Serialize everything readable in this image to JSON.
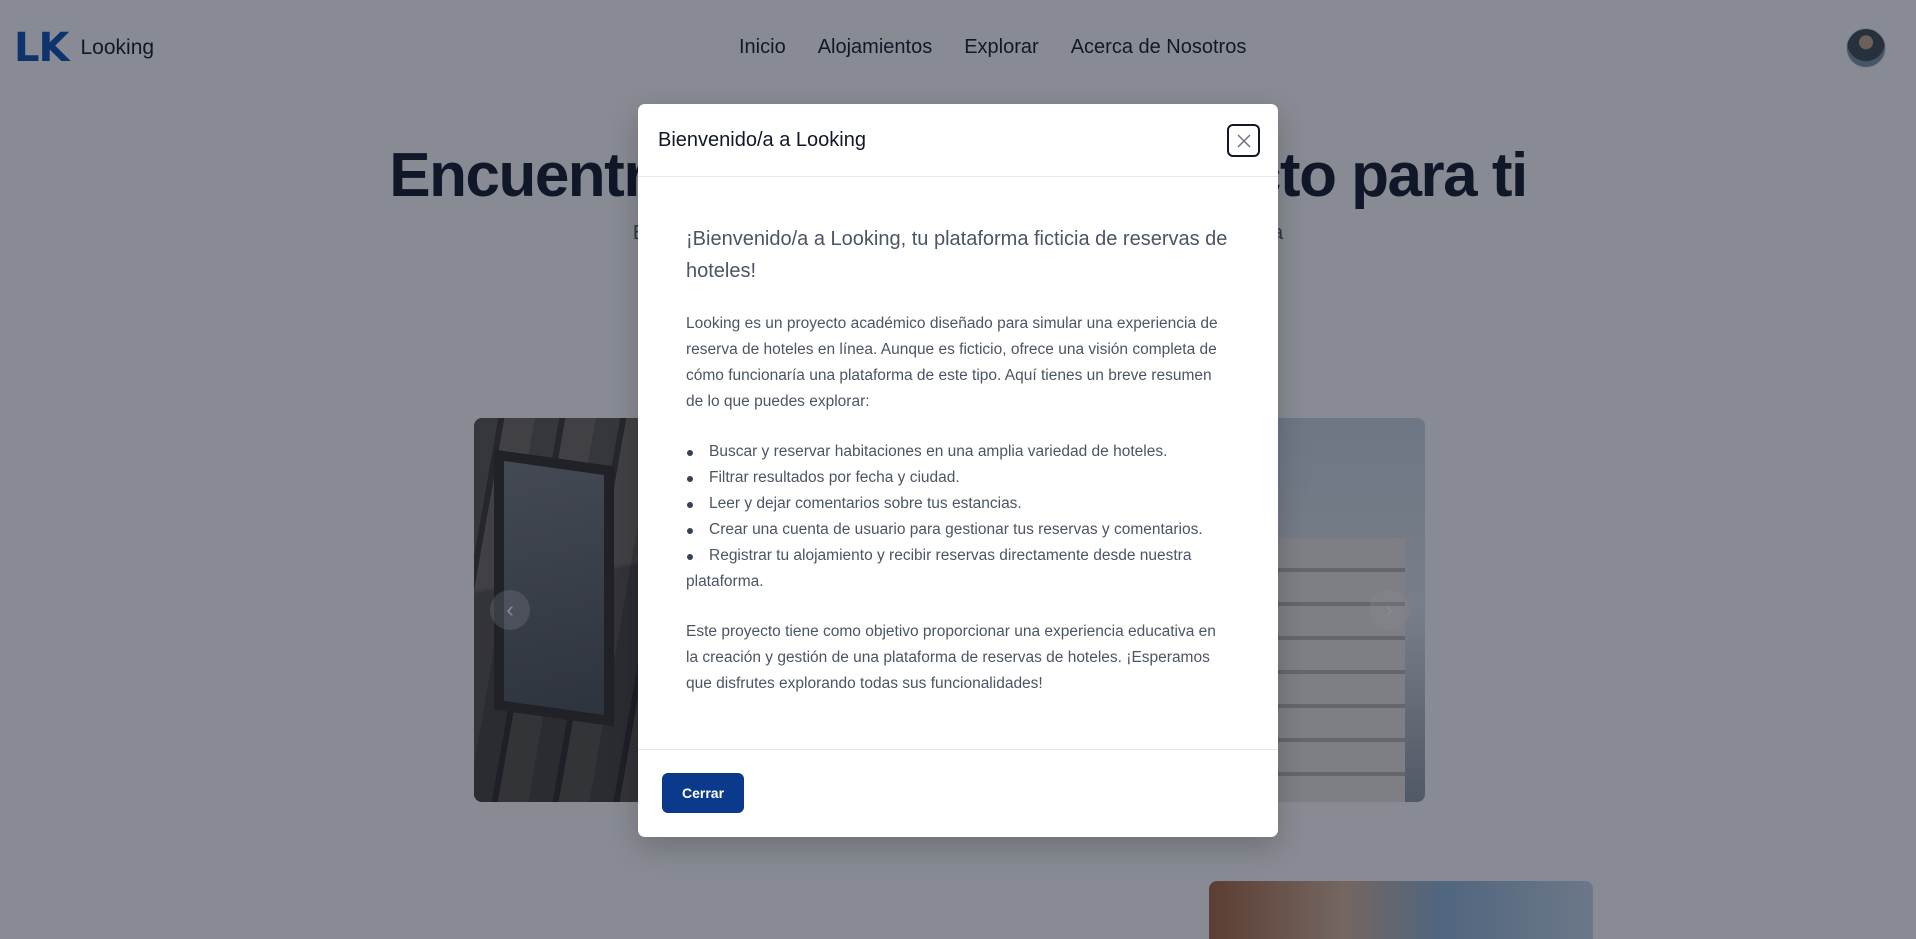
{
  "navbar": {
    "logo_mark": "LK",
    "logo_text": "Looking",
    "links": [
      {
        "label": "Inicio"
      },
      {
        "label": "Alojamientos"
      },
      {
        "label": "Explorar"
      },
      {
        "label": "Acerca de Nosotros"
      }
    ],
    "avatar_icon": "user-avatar"
  },
  "hero": {
    "title": "Encuentra el alojamiento perfecto para ti",
    "subtitle": "Explora nuestros alojamientos y reserva tu estancia ideal para tu próxima"
  },
  "carousel": {
    "prev_icon": "chevron-left-icon",
    "next_icon": "chevron-right-icon"
  },
  "modal": {
    "title": "Bienvenido/a a Looking",
    "close_icon": "close-icon",
    "lead": "¡Bienvenido/a a Looking, tu plataforma ficticia de reservas de hoteles!",
    "intro": "Looking es un proyecto académico diseñado para simular una experiencia de reserva de hoteles en línea. Aunque es ficticio, ofrece una visión completa de cómo funcionaría una plataforma de este tipo. Aquí tienes un breve resumen de lo que puedes explorar:",
    "features": [
      "Buscar y reservar habitaciones en una amplia variedad de hoteles.",
      "Filtrar resultados por fecha y ciudad.",
      "Leer y dejar comentarios sobre tus estancias.",
      "Crear una cuenta de usuario para gestionar tus reservas y comentarios.",
      "Registrar tu alojamiento y recibir reservas directamente desde nuestra plataforma."
    ],
    "closing": "Este proyecto tiene como objetivo proporcionar una experiencia educativa en la creación y gestión de una plataforma de reservas de hoteles. ¡Esperamos que disfrutes explorando todas sus funcionalidades!",
    "close_button_label": "Cerrar"
  },
  "colors": {
    "brand": "#0b3a8c",
    "logo": "#0b4fb3",
    "overlay": "rgba(17,24,39,0.5)"
  }
}
